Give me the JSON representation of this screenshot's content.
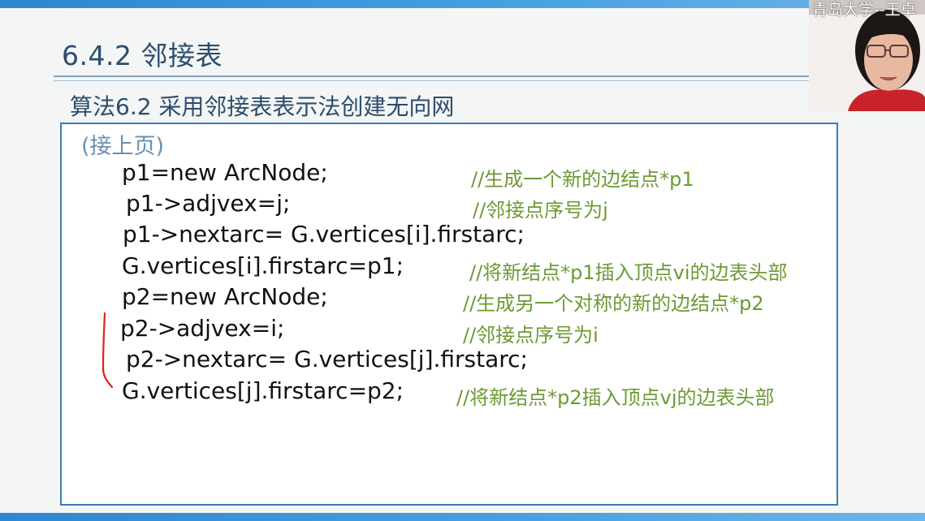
{
  "slide": {
    "title": "6.4.2 邻接表",
    "subtitle": "算法6.2 采用邻接表表示法创建无向网",
    "continued": "(接上页)"
  },
  "code_lines": [
    {
      "code": "p1=new ArcNode;",
      "comment": "//生成一个新的边结点*p1"
    },
    {
      "code": "p1->adjvex=j;",
      "comment": "//邻接点序号为j"
    },
    {
      "code": "p1->nextarc= G.vertices[i].firstarc;",
      "comment": ""
    },
    {
      "code": "G.vertices[i].firstarc=p1;",
      "comment": "//将新结点*p1插入顶点vi的边表头部"
    },
    {
      "code": "p2=new ArcNode;",
      "comment": "//生成另一个对称的新的边结点*p2"
    },
    {
      "code": "p2->adjvex=i;",
      "comment": "//邻接点序号为i"
    },
    {
      "code": "p2->nextarc= G.vertices[j].firstarc;",
      "comment": ""
    },
    {
      "code": "G.vertices[j].firstarc=p2;",
      "comment": "//将新结点*p2插入顶点vj的边表头部"
    }
  ],
  "webcam": {
    "label": "青岛大学--王卓"
  },
  "colors": {
    "title": "#2b4d6e",
    "comment": "#6c9a34",
    "frame": "#3f79b4",
    "annotation": "#e0201c"
  }
}
